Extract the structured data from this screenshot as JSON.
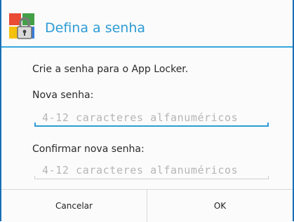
{
  "dialog": {
    "title": "Defina a senha",
    "icon": "app-locker-padlock-icon",
    "instruction": "Crie a senha para o App Locker.",
    "new_password": {
      "label": "Nova senha:",
      "value": "",
      "placeholder": "4-12 caracteres alfanuméricos"
    },
    "confirm_password": {
      "label": "Confirmar nova senha:",
      "value": "",
      "placeholder": "4-12 caracteres alfanuméricos"
    },
    "buttons": {
      "cancel": "Cancelar",
      "ok": "OK"
    }
  },
  "colors": {
    "accent": "#2d9bd4",
    "frame": "#1a6fb4",
    "text": "#2a2a2a",
    "placeholder": "#b5b5b5"
  }
}
